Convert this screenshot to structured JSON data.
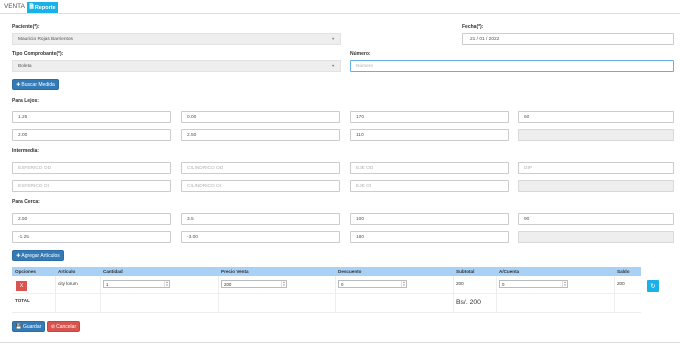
{
  "tabs": {
    "venta": "VENTA",
    "reporte": "Reporte"
  },
  "paciente": {
    "label": "Paciente(*):",
    "value": "Mauricio Rojas Barrientos"
  },
  "fecha": {
    "label": "Fecha(*):",
    "value": "21 / 01 / 2022"
  },
  "tipo_comprobante": {
    "label": "Tipo Comprobante(*):",
    "value": "Boleta"
  },
  "numero": {
    "label": "Número:",
    "placeholder": "Número"
  },
  "buscar_medida": "Buscar Medida",
  "lejos": {
    "label": "Para Lejos:",
    "row1": [
      "1.25",
      "0.00",
      "170",
      "60"
    ],
    "row2": [
      "2.00",
      "2.50",
      "110",
      ""
    ]
  },
  "intermedia": {
    "label": "Intermedia:",
    "row1": [
      "ESFERICO OD",
      "CILINDRICO OD",
      "EJE OD",
      "DIP"
    ],
    "row2": [
      "ESFERICO OI",
      "CILINDRICO OI",
      "EJE OI",
      ""
    ]
  },
  "cerca": {
    "label": "Para Cerca:",
    "row1": [
      "2.50",
      "3.5",
      "100",
      "90"
    ],
    "row2": [
      "-1.25",
      "-3.00",
      "180",
      ""
    ]
  },
  "agregar_articulos": "Agregar Artículos",
  "table": {
    "headers": [
      "Opciones",
      "Artículo",
      "Cantidad",
      "Precio Venta",
      "Descuento",
      "Subtotal",
      "A/Cuenta",
      "Saldo"
    ],
    "row": {
      "delete": "X",
      "articulo": "city lorum",
      "cantidad": "1",
      "precio": "200",
      "descuento": "0",
      "subtotal": "200",
      "a_cuenta": "0",
      "saldo": "200"
    },
    "total_label": "TOTAL",
    "total_value": "Bs/. 200"
  },
  "buttons": {
    "guardar": "Guardar",
    "cancelar": "Cancelar"
  },
  "colors": {
    "primary": "#337ab7",
    "info": "#1ab1e6",
    "danger": "#d9534f",
    "table_header": "#a9d0f5"
  },
  "icons": {
    "reporte": "file-icon",
    "buscar": "plus-icon",
    "agregar": "plus-icon",
    "refresh": "refresh-icon",
    "guardar": "save-icon",
    "cancelar": "cancel-icon"
  }
}
